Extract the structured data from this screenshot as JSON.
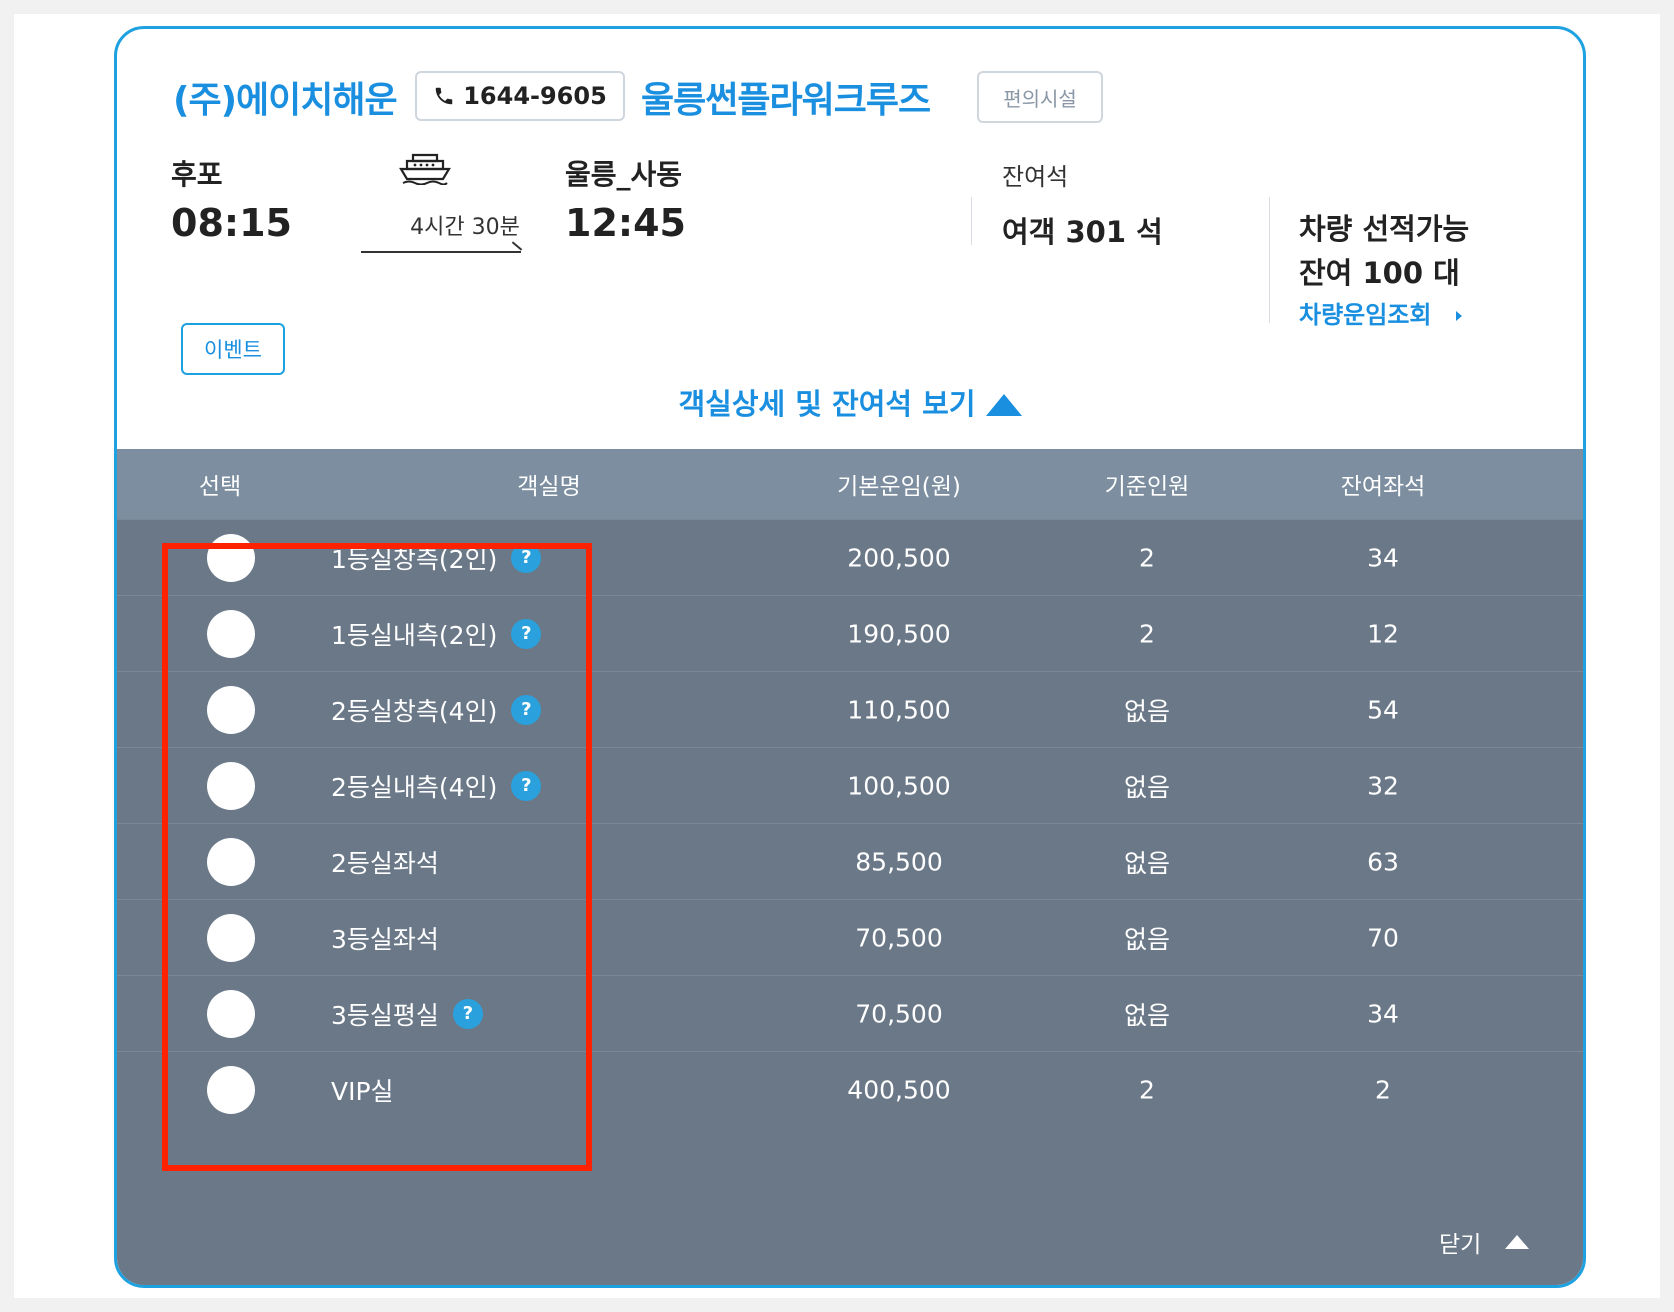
{
  "header": {
    "company": "(주)에이치해운",
    "phone": "1644-9605",
    "ship_name": "울릉썬플라워크루즈",
    "facility_label": "편의시설"
  },
  "route": {
    "departure_port": "후포",
    "departure_time": "08:15",
    "duration": "4시간 30분",
    "arrival_port": "울릉_사동",
    "arrival_time": "12:45"
  },
  "seats": {
    "label": "잔여석",
    "passenger": "여객 301 석",
    "vehicle_line1": "차량 선적가능",
    "vehicle_line2": "잔여 100 대",
    "vehicle_link": "차량운임조회"
  },
  "event_label": "이벤트",
  "detail_toggle_label": "객실상세 및 잔여석 보기",
  "table": {
    "headers": {
      "select": "선택",
      "name": "객실명",
      "fare": "기본운임(원)",
      "capacity": "기준인원",
      "remaining": "잔여좌석"
    },
    "rows": [
      {
        "name": "1등실창측(2인)",
        "help": "?",
        "fare": "200,500",
        "capacity": "2",
        "remaining": "34"
      },
      {
        "name": "1등실내측(2인)",
        "help": "?",
        "fare": "190,500",
        "capacity": "2",
        "remaining": "12"
      },
      {
        "name": "2등실창측(4인)",
        "help": "?",
        "fare": "110,500",
        "capacity": "없음",
        "remaining": "54"
      },
      {
        "name": "2등실내측(4인)",
        "help": "?",
        "fare": "100,500",
        "capacity": "없음",
        "remaining": "32"
      },
      {
        "name": "2등실좌석",
        "help": "",
        "fare": "85,500",
        "capacity": "없음",
        "remaining": "63"
      },
      {
        "name": "3등실좌석",
        "help": "",
        "fare": "70,500",
        "capacity": "없음",
        "remaining": "70"
      },
      {
        "name": "3등실평실",
        "help": "?",
        "fare": "70,500",
        "capacity": "없음",
        "remaining": "34"
      },
      {
        "name": "VIP실",
        "help": "",
        "fare": "400,500",
        "capacity": "2",
        "remaining": "2"
      }
    ]
  },
  "close_label": "닫기",
  "colors": {
    "accent": "#1a8fe0",
    "table_bg": "#6a7888",
    "table_header_bg": "#7c8ea0",
    "highlight": "#ff2200"
  },
  "icons": {
    "phone": "phone-icon",
    "ship": "ship-icon",
    "help": "help-icon"
  }
}
